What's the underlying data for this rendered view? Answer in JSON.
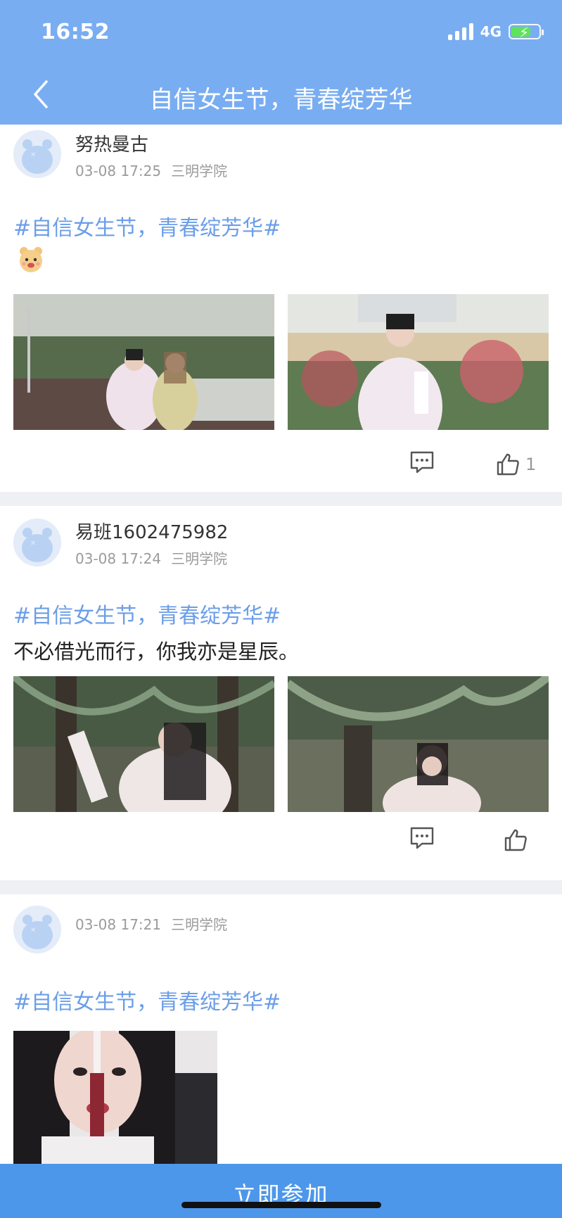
{
  "status": {
    "time": "16:52",
    "network": "4G"
  },
  "nav": {
    "title": "自信女生节，青春绽芳华"
  },
  "posts": [
    {
      "username": "努热曼古",
      "date": "03-08 17:25",
      "school": "三明学院",
      "topic": "#自信女生节，青春绽芳华#",
      "text": "",
      "like_count": "1"
    },
    {
      "username": "易班1602475982",
      "date": "03-08 17:24",
      "school": "三明学院",
      "topic": "#自信女生节，青春绽芳华#",
      "text": "不必借光而行，你我亦是星辰。",
      "like_count": ""
    },
    {
      "username": "",
      "date": "03-08 17:21",
      "school": "三明学院",
      "topic": "#自信女生节，青春绽芳华#",
      "text": "",
      "like_count": ""
    }
  ],
  "join_button": {
    "label": "立即参加"
  },
  "colors": {
    "header": "#79adf1",
    "topic": "#6b9ee8",
    "join": "#4d97ea",
    "divider": "#eff0f4"
  }
}
